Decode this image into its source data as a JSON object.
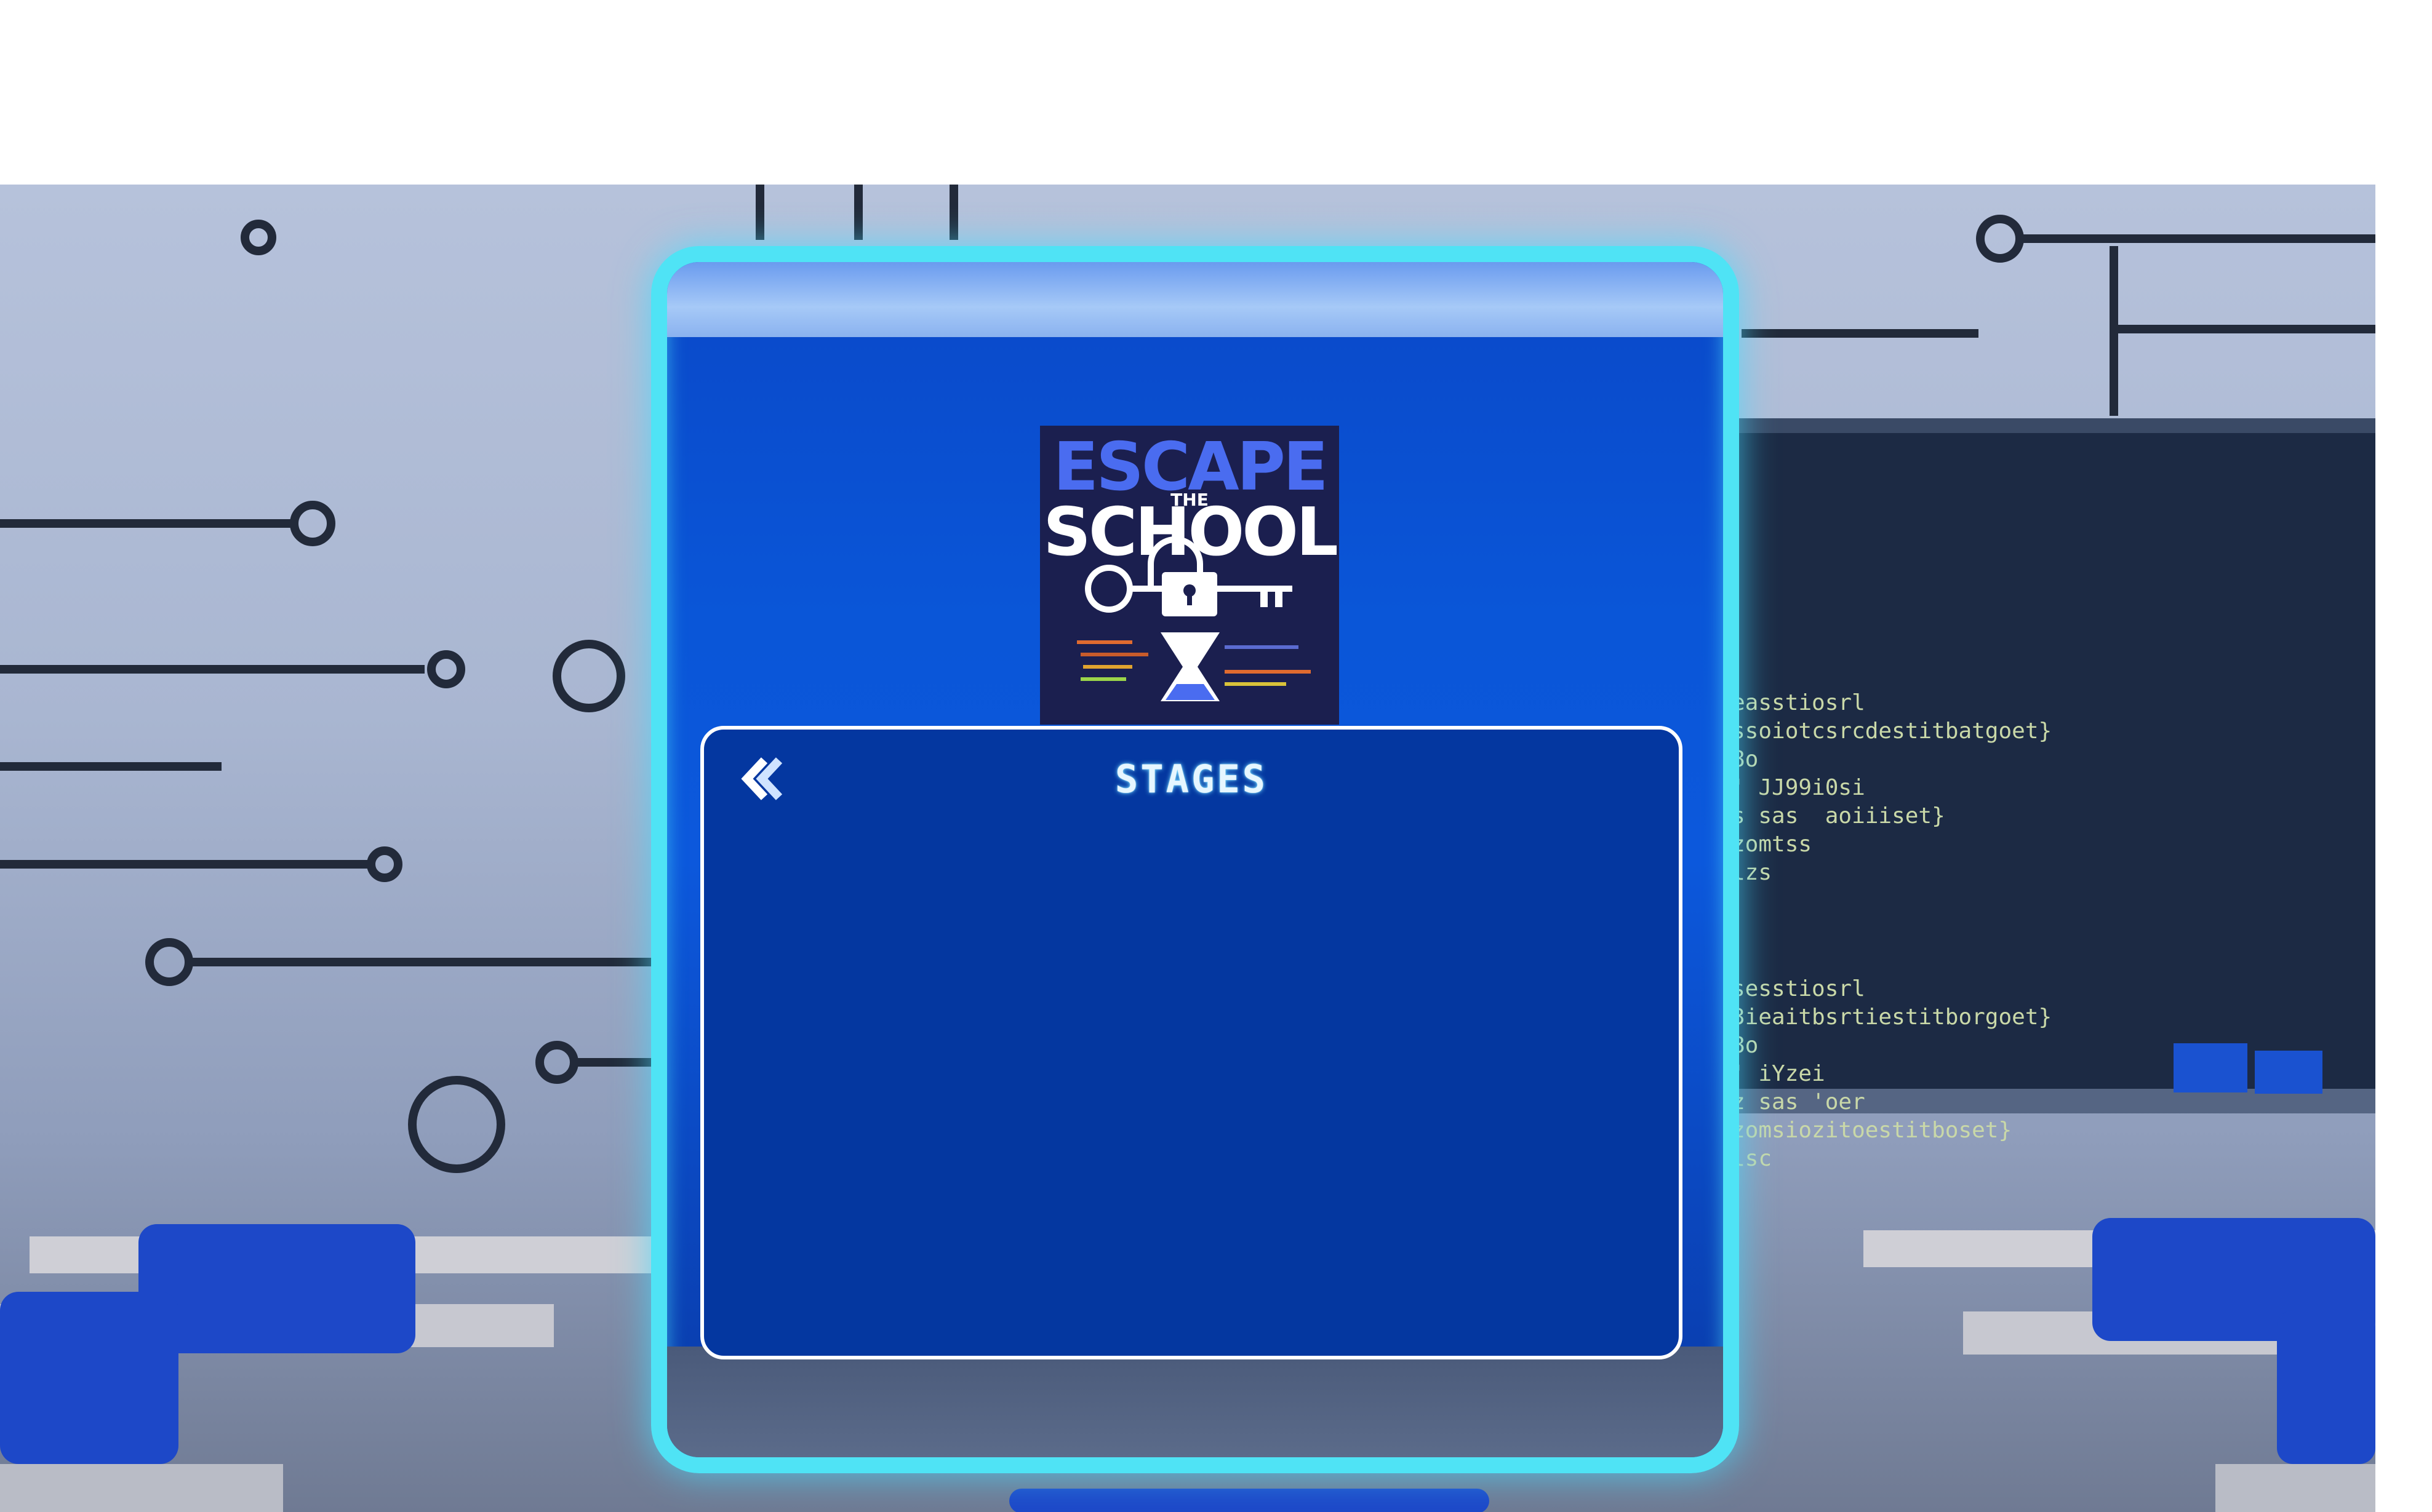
{
  "game": {
    "logo": {
      "title": "ESCAPE",
      "the": "THE",
      "subtitle": "SCHOOL"
    },
    "dialog": {
      "title": "STAGES",
      "back_icon": "double-chevron-left-icon"
    },
    "chalkboard": {
      "lines_a": [
        "easstiosrl",
        "ssoiotcsrcdestitbatgoet}",
        "8o",
        "' JJ99i0si",
        "s sas  aoiiiset}",
        "zomtss",
        "lzs"
      ],
      "lines_b": [
        "sesstiosrl",
        "3ieaitbsrtiestitborgoet}",
        "8o",
        "' iYzei",
        "z sas 'oer",
        "zomsiozitoestitboset}",
        "lsc"
      ]
    }
  },
  "colors": {
    "frame_glow": "#4fe3f5",
    "panel_blue": "#0a52d4",
    "dialog_blue": "#0437a0",
    "logo_bg": "#1b1f4f",
    "logo_accent": "#4a6cf0"
  }
}
